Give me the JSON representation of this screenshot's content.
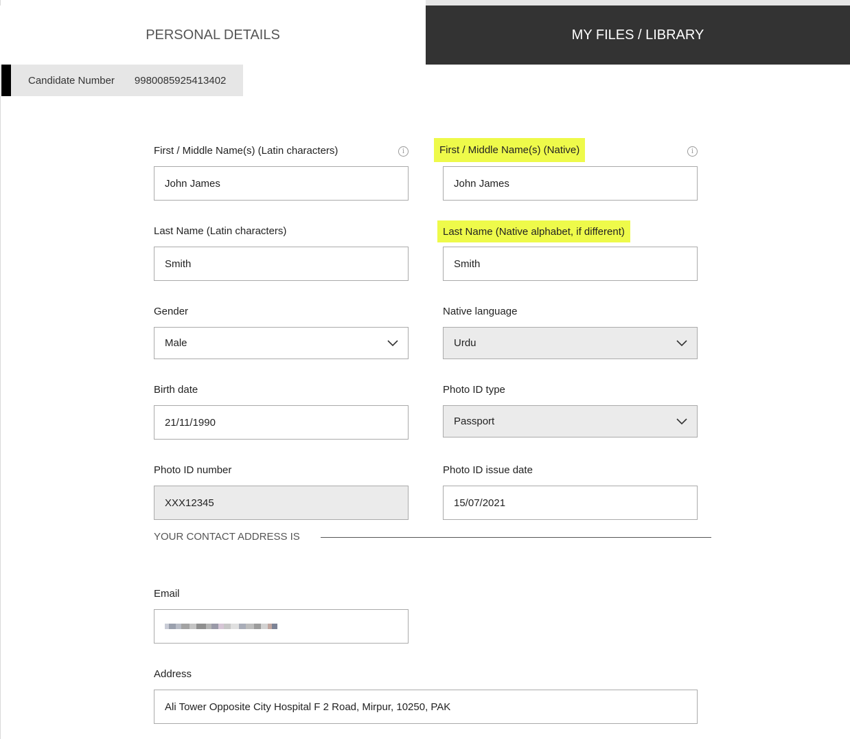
{
  "tabs": {
    "personal": "PERSONAL DETAILS",
    "files": "MY FILES / LIBRARY"
  },
  "candidate": {
    "label": "Candidate Number",
    "value": "9980085925413402"
  },
  "form": {
    "first_name_latin": {
      "label": "First / Middle Name(s) (Latin characters)",
      "value": "John James"
    },
    "first_name_native": {
      "label": "First / Middle Name(s) (Native)",
      "value": "John James"
    },
    "last_name_latin": {
      "label": "Last Name (Latin characters)",
      "value": "Smith"
    },
    "last_name_native": {
      "label": "Last Name (Native alphabet, if different)",
      "value": "Smith"
    },
    "gender": {
      "label": "Gender",
      "value": "Male"
    },
    "native_language": {
      "label": "Native language",
      "value": "Urdu"
    },
    "birth_date": {
      "label": "Birth date",
      "value": "21/11/1990"
    },
    "photo_id_type": {
      "label": "Photo ID type",
      "value": "Passport"
    },
    "photo_id_number": {
      "label": "Photo ID number",
      "value": "XXX12345"
    },
    "photo_id_issue_date": {
      "label": "Photo ID issue date",
      "value": "15/07/2021"
    }
  },
  "contact": {
    "heading": "YOUR CONTACT ADDRESS IS",
    "email_label": "Email",
    "address_label": "Address",
    "address_value": "Ali Tower Opposite City Hospital F 2 Road, Mirpur, 10250, PAK"
  },
  "colors": {
    "highlight": "#eefa4a",
    "dark_tab": "#333333",
    "readonly_field": "#ebebeb"
  },
  "icons": [
    "info-icon",
    "chevron-down-icon"
  ]
}
